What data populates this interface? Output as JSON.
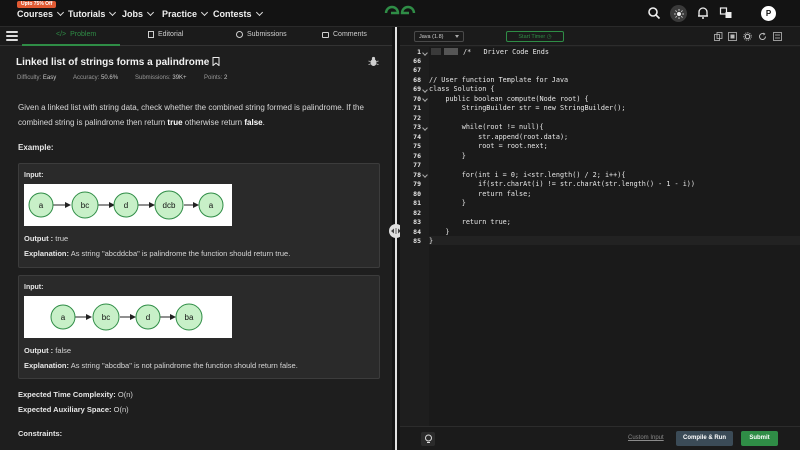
{
  "nav": {
    "promo": "Upto 75% Off",
    "items": [
      "Courses",
      "Tutorials",
      "Jobs",
      "Practice",
      "Contests"
    ],
    "avatar_letter": "P"
  },
  "left_tabs": [
    "Problem",
    "Editorial",
    "Submissions",
    "Comments"
  ],
  "problem": {
    "title": "Linked list of strings forms a palindrome",
    "difficulty_label": "Difficulty:",
    "difficulty": "Easy",
    "accuracy_label": "Accuracy:",
    "accuracy": "50.6%",
    "submissions_label": "Submissions:",
    "submissions": "39K+",
    "points_label": "Points:",
    "points": "2",
    "desc_1": "Given a linked list with string data, check whether the combined string formed is palindrome. If the combined string is palindrome then return ",
    "desc_true": "true",
    "desc_2": " otherwise return ",
    "desc_false": "false",
    "desc_3": ".",
    "example_heading": "Example:"
  },
  "examples": [
    {
      "input_label": "Input:",
      "nodes": [
        "a",
        "bc",
        "d",
        "dcb",
        "a"
      ],
      "output_label": "Output :",
      "output": "true",
      "explanation_label": "Explanation:",
      "explanation": "As string \"abcddcba\" is palindrome the function should return true."
    },
    {
      "input_label": "Input:",
      "nodes": [
        "a",
        "bc",
        "d",
        "ba"
      ],
      "output_label": "Output :",
      "output": "false",
      "explanation_label": "Explanation:",
      "explanation": "As string \"abcdba\" is not palindrome the function should return false."
    }
  ],
  "complexity": {
    "time_label": "Expected Time Complexity:",
    "time": "O(n)",
    "space_label": "Expected Auxiliary Space:",
    "space": "O(n)",
    "constraints_label": "Constraints:"
  },
  "editor": {
    "language": "Java (1.8)",
    "timer_label": "Start Timer",
    "line_numbers": [
      "1",
      "66",
      "67",
      "68",
      "69",
      "70",
      "71",
      "72",
      "73",
      "74",
      "75",
      "76",
      "77",
      "78",
      "79",
      "80",
      "81",
      "82",
      "83",
      "84",
      "85"
    ],
    "lines": [
      "/*   Driver Code Ends",
      "",
      "",
      "// User function Template for Java",
      "class Solution {",
      "    public boolean compute(Node root) {",
      "        StringBuilder str = new StringBuilder();",
      "",
      "        while(root != null){",
      "            str.append(root.data);",
      "            root = root.next;",
      "        }",
      "",
      "        for(int i = 0; i<str.length() / 2; i++){",
      "            if(str.charAt(i) != str.charAt(str.length() - 1 - i))",
      "            return false;",
      "        }",
      "",
      "        return true;",
      "    }",
      "}"
    ]
  },
  "bottom": {
    "custom_input": "Custom Input",
    "compile_label": "Compile & Run",
    "submit_label": "Submit"
  },
  "colors": {
    "accent": "#2f8d46",
    "node_fill": "#c8f0c8",
    "node_stroke": "#2f8d46"
  }
}
